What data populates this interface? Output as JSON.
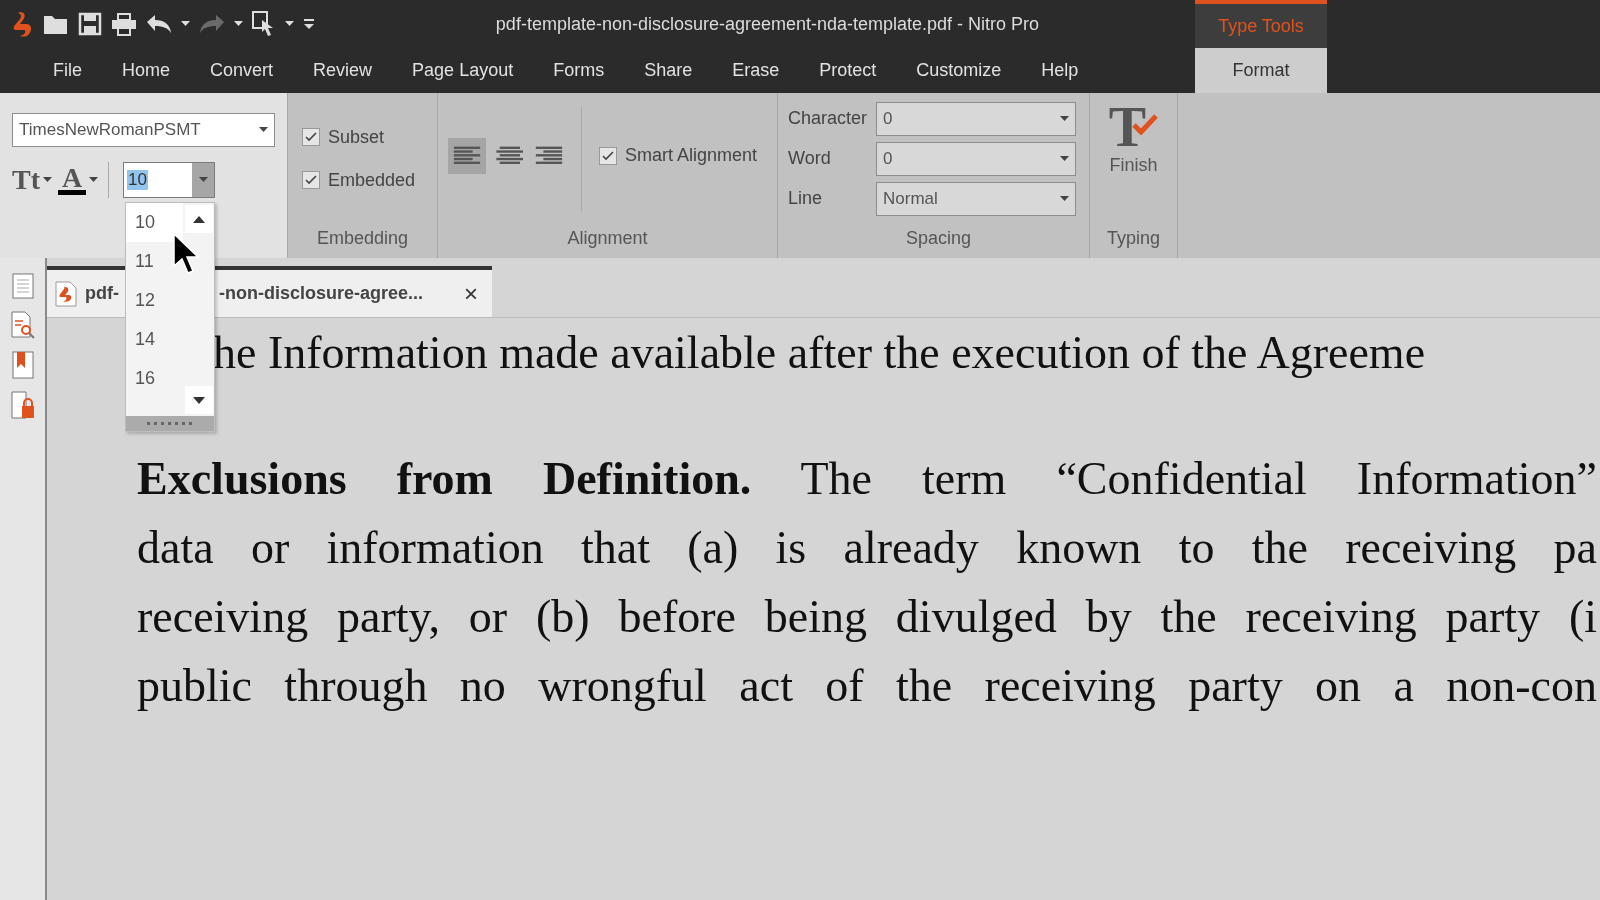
{
  "window": {
    "title": "pdf-template-non-disclosure-agreement-nda-template.pdf - Nitro Pro",
    "context_tab_header": "Type Tools"
  },
  "quick_access": [
    {
      "kind": "open",
      "disabled": false
    },
    {
      "kind": "save",
      "disabled": false
    },
    {
      "kind": "print",
      "disabled": false
    },
    {
      "kind": "undo",
      "disabled": false
    },
    {
      "kind": "caret",
      "disabled": false
    },
    {
      "kind": "redo",
      "disabled": true
    },
    {
      "kind": "caret",
      "disabled": false
    },
    {
      "kind": "select",
      "disabled": false
    },
    {
      "kind": "caret",
      "disabled": false
    },
    {
      "kind": "customize",
      "disabled": false
    }
  ],
  "menu_tabs": [
    {
      "label": "File",
      "selected": false
    },
    {
      "label": "Home",
      "selected": false
    },
    {
      "label": "Convert",
      "selected": false
    },
    {
      "label": "Review",
      "selected": false
    },
    {
      "label": "Page Layout",
      "selected": false
    },
    {
      "label": "Forms",
      "selected": false
    },
    {
      "label": "Share",
      "selected": false
    },
    {
      "label": "Erase",
      "selected": false
    },
    {
      "label": "Protect",
      "selected": false
    },
    {
      "label": "Customize",
      "selected": false
    },
    {
      "label": "Help",
      "selected": false
    },
    {
      "label": "Format",
      "selected": true
    }
  ],
  "ribbon": {
    "font": {
      "family": "TimesNewRomanPSMT",
      "text_size_button": "Tt",
      "font_color_button": "A",
      "size": "10"
    },
    "embedding": {
      "label": "Embedding",
      "options": [
        {
          "label": "Subset",
          "checked": true
        },
        {
          "label": "Embedded",
          "checked": true
        }
      ]
    },
    "alignment": {
      "label": "Alignment",
      "buttons": [
        {
          "kind": "left",
          "selected": true
        },
        {
          "kind": "center",
          "selected": false
        },
        {
          "kind": "right",
          "selected": false
        }
      ],
      "smart_alignment": {
        "label": "Smart Alignment",
        "checked": true
      }
    },
    "spacing": {
      "label": "Spacing",
      "fields": [
        {
          "label": "Character",
          "value": "0"
        },
        {
          "label": "Word",
          "value": "0"
        },
        {
          "label": "Line",
          "value": "Normal"
        }
      ]
    },
    "typing": {
      "label": "Typing",
      "icon_letter": "T",
      "button": "Finish"
    }
  },
  "size_dropdown": {
    "items": [
      {
        "label": "10",
        "selected": true
      },
      {
        "label": "11",
        "selected": false
      },
      {
        "label": "12",
        "selected": false
      },
      {
        "label": "14",
        "selected": false
      },
      {
        "label": "16",
        "selected": false
      }
    ]
  },
  "sidebar": {
    "buttons": [
      {
        "kind": "pages"
      },
      {
        "kind": "search"
      },
      {
        "kind": "bookmarks"
      },
      {
        "kind": "security"
      }
    ]
  },
  "document_tab": {
    "label_start": "pdf-",
    "label_end": "-non-disclosure-agree...",
    "close": "×",
    "selected": true
  },
  "document": {
    "paragraphs": [
      {
        "lines": [
          "he Information made available after the execution of the Agreeme"
        ]
      },
      {
        "lines": [
          "**Exclusions from Definition.** The term “Confidential Information”",
          "data or information that (a) is already known to the receiving pa",
          "receiving party, or (b) before being divulged by the receiving party (i",
          "public through no wrongful act of the receiving party on a non-con"
        ]
      }
    ]
  }
}
